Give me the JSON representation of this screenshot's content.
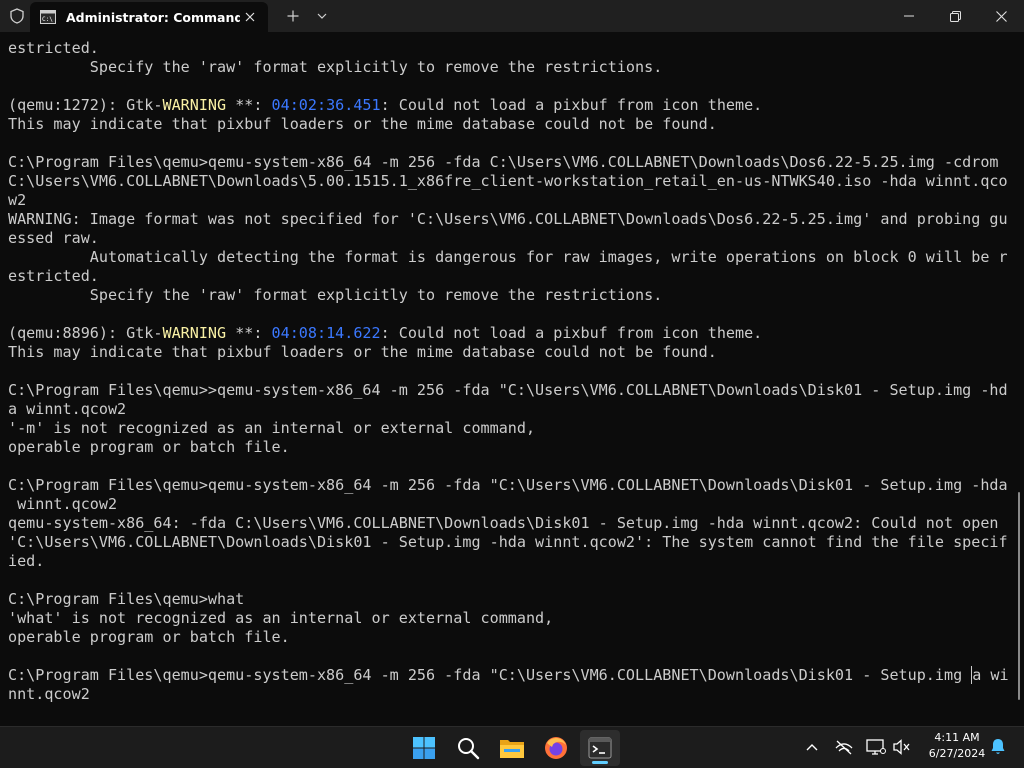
{
  "window": {
    "tab_title": "Administrator: Command Pro",
    "icons": {
      "shield": "shield-icon",
      "tab": "command-prompt-icon",
      "close_tab": "close-icon",
      "new_tab": "plus-icon",
      "dropdown": "chevron-down-icon",
      "minimize": "minimize-icon",
      "maximize": "restore-icon",
      "close": "close-icon"
    }
  },
  "colors": {
    "terminal_bg": "#0c0c0c",
    "terminal_text": "#cccccc",
    "warning_text": "#f9f1a5",
    "timestamp_text": "#3b78ff",
    "titlebar_bg": "#202020",
    "taskbar_bg": "#1c1c1c",
    "accent": "#60cdff"
  },
  "terminal": {
    "lines": [
      [
        {
          "t": "estricted."
        }
      ],
      [
        {
          "t": "         Specify the 'raw' format explicitly to remove the restrictions."
        }
      ],
      [
        {
          "t": ""
        }
      ],
      [
        {
          "t": "(qemu:1272): Gtk-"
        },
        {
          "t": "WARNING",
          "c": "warn"
        },
        {
          "t": " **: "
        },
        {
          "t": "04:02:36.451",
          "c": "ts"
        },
        {
          "t": ": Could not load a pixbuf from icon theme."
        }
      ],
      [
        {
          "t": "This may indicate that pixbuf loaders or the mime database could not be found."
        }
      ],
      [
        {
          "t": ""
        }
      ],
      [
        {
          "t": "C:\\Program Files\\qemu>qemu-system-x86_64 -m 256 -fda C:\\Users\\VM6.COLLABNET\\Downloads\\Dos6.22-5.25.img -cdrom"
        }
      ],
      [
        {
          "t": "C:\\Users\\VM6.COLLABNET\\Downloads\\5.00.1515.1_x86fre_client-workstation_retail_en-us-NTWKS40.iso -hda winnt.qco"
        }
      ],
      [
        {
          "t": "w2"
        }
      ],
      [
        {
          "t": "WARNING: Image format was not specified for 'C:\\Users\\VM6.COLLABNET\\Downloads\\Dos6.22-5.25.img' and probing gu"
        }
      ],
      [
        {
          "t": "essed raw."
        }
      ],
      [
        {
          "t": "         Automatically detecting the format is dangerous for raw images, write operations on block 0 will be r"
        }
      ],
      [
        {
          "t": "estricted."
        }
      ],
      [
        {
          "t": "         Specify the 'raw' format explicitly to remove the restrictions."
        }
      ],
      [
        {
          "t": ""
        }
      ],
      [
        {
          "t": "(qemu:8896): Gtk-"
        },
        {
          "t": "WARNING",
          "c": "warn"
        },
        {
          "t": " **: "
        },
        {
          "t": "04:08:14.622",
          "c": "ts"
        },
        {
          "t": ": Could not load a pixbuf from icon theme."
        }
      ],
      [
        {
          "t": "This may indicate that pixbuf loaders or the mime database could not be found."
        }
      ],
      [
        {
          "t": ""
        }
      ],
      [
        {
          "t": "C:\\Program Files\\qemu>>qemu-system-x86_64 -m 256 -fda \"C:\\Users\\VM6.COLLABNET\\Downloads\\Disk01 - Setup.img -hd"
        }
      ],
      [
        {
          "t": "a winnt.qcow2"
        }
      ],
      [
        {
          "t": "'-m' is not recognized as an internal or external command,"
        }
      ],
      [
        {
          "t": "operable program or batch file."
        }
      ],
      [
        {
          "t": ""
        }
      ],
      [
        {
          "t": "C:\\Program Files\\qemu>qemu-system-x86_64 -m 256 -fda \"C:\\Users\\VM6.COLLABNET\\Downloads\\Disk01 - Setup.img -hda"
        }
      ],
      [
        {
          "t": " winnt.qcow2"
        }
      ],
      [
        {
          "t": "qemu-system-x86_64: -fda C:\\Users\\VM6.COLLABNET\\Downloads\\Disk01 - Setup.img -hda winnt.qcow2: Could not open"
        }
      ],
      [
        {
          "t": "'C:\\Users\\VM6.COLLABNET\\Downloads\\Disk01 - Setup.img -hda winnt.qcow2': The system cannot find the file specif"
        }
      ],
      [
        {
          "t": "ied."
        }
      ],
      [
        {
          "t": ""
        }
      ],
      [
        {
          "t": "C:\\Program Files\\qemu>what"
        }
      ],
      [
        {
          "t": "'what' is not recognized as an internal or external command,"
        }
      ],
      [
        {
          "t": "operable program or batch file."
        }
      ],
      [
        {
          "t": ""
        }
      ],
      [
        {
          "t": "C:\\Program Files\\qemu>qemu-system-x86_64 -m 256 -fda \"C:\\Users\\VM6.COLLABNET\\Downloads\\Disk01 - Setup.img "
        },
        {
          "t": "a",
          "c": "cursor"
        },
        {
          "t": " wi"
        }
      ],
      [
        {
          "t": "nnt.qcow2"
        }
      ]
    ]
  },
  "taskbar": {
    "apps": [
      {
        "name": "start-button",
        "icon": "windows-logo-icon"
      },
      {
        "name": "search-button",
        "icon": "search-icon"
      },
      {
        "name": "file-explorer-button",
        "icon": "folder-icon"
      },
      {
        "name": "firefox-button",
        "icon": "firefox-icon"
      },
      {
        "name": "terminal-button",
        "icon": "terminal-icon",
        "active": true
      }
    ],
    "tray": {
      "icons": [
        "chevron-up-icon",
        "network-off-icon",
        "display-icon",
        "speaker-muted-icon"
      ],
      "time": "4:11 AM",
      "date": "6/27/2024",
      "notification_icon": "bell-icon"
    }
  }
}
